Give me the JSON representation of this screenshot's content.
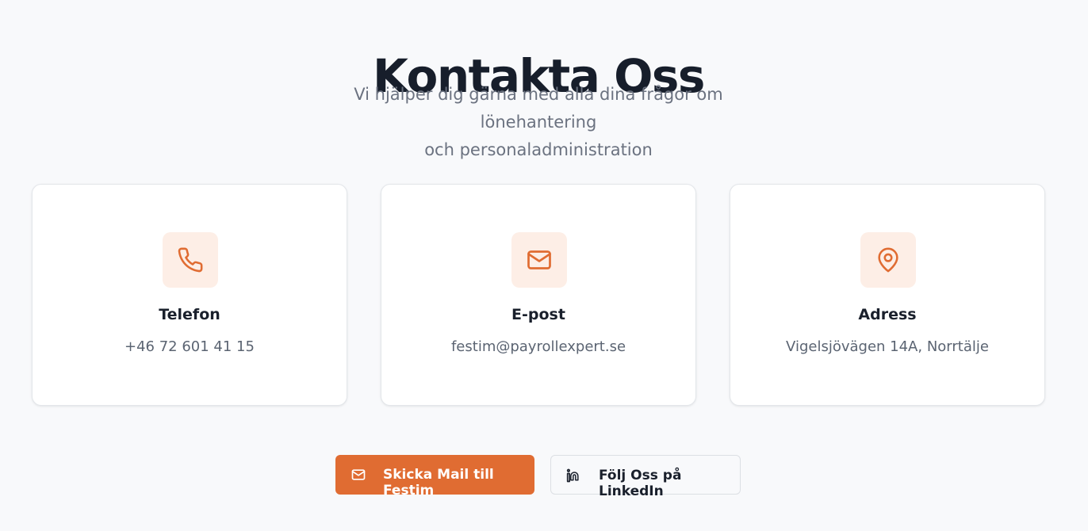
{
  "header": {
    "title": "Kontakta Oss",
    "subtitle_line1": "Vi hjälper dig gärna med alla dina frågor om lönehantering",
    "subtitle_line2": "och personaladministration"
  },
  "cards": [
    {
      "icon": "phone-icon",
      "label": "Telefon",
      "value": "+46 72 601 41 15"
    },
    {
      "icon": "mail-icon",
      "label": "E-post",
      "value": "festim@payrollexpert.se"
    },
    {
      "icon": "map-pin-icon",
      "label": "Adress",
      "value": "Vigelsjövägen 14A, Norrtälje"
    }
  ],
  "actions": {
    "mail_button": {
      "icon": "mail-icon",
      "label": "Skicka Mail till Festim"
    },
    "linkedin_button": {
      "icon": "linkedin-icon",
      "label": "Följ Oss på LinkedIn"
    }
  },
  "colors": {
    "accent": "#e06c32",
    "icon_bg": "#fdeee6",
    "page_bg": "#f8f9fb",
    "heading": "#171e2b",
    "muted_text": "#6b7280"
  }
}
